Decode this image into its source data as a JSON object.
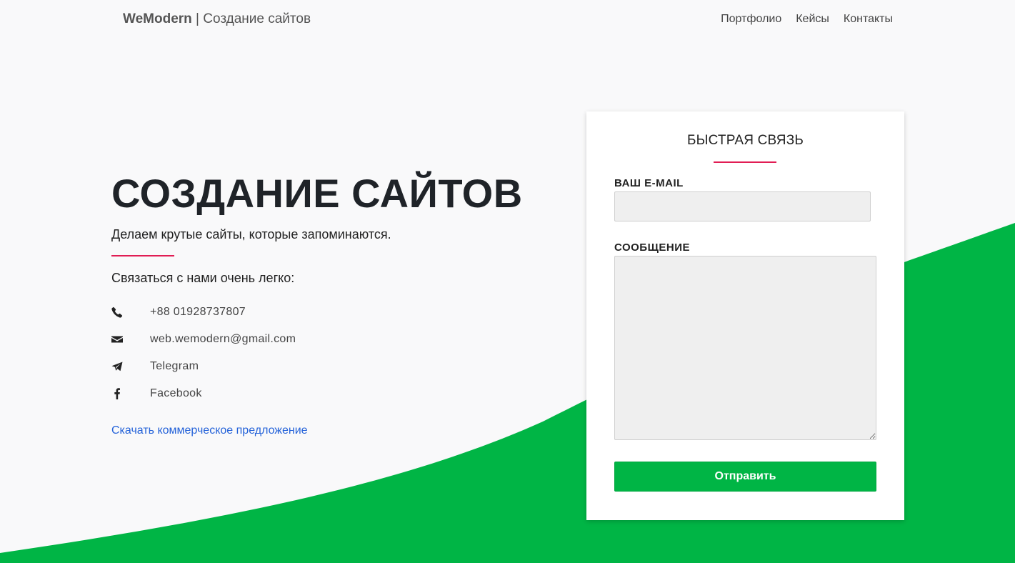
{
  "header": {
    "brand_name": "WeModern",
    "brand_separator": " | ",
    "brand_tagline": "Создание сайтов",
    "nav": [
      {
        "label": "Портфолио"
      },
      {
        "label": "Кейсы"
      },
      {
        "label": "Контакты"
      }
    ]
  },
  "hero": {
    "title": "СОЗДАНИЕ САЙТОВ",
    "subtitle": "Делаем крутые сайты, которые запоминаются.",
    "contact_heading": "Связаться с нами очень легко:",
    "contacts": [
      {
        "icon": "phone-icon",
        "text": "+88 01928737807"
      },
      {
        "icon": "envelope-icon",
        "text": "web.wemodern@gmail.com"
      },
      {
        "icon": "telegram-icon",
        "text": "Telegram"
      },
      {
        "icon": "facebook-icon",
        "text": "Facebook"
      }
    ],
    "download_link": "Скачать коммерческое предложение"
  },
  "form": {
    "title": "БЫСТРАЯ СВЯЗЬ",
    "email_label": "ВАШ E-MAIL",
    "email_value": "",
    "message_label": "СООБЩЕНИЕ",
    "message_value": "",
    "submit_label": "Отправить"
  },
  "colors": {
    "accent_green": "#00b545",
    "accent_red": "#e11d54",
    "link_blue": "#2563d9",
    "background": "#f9f9fa"
  }
}
